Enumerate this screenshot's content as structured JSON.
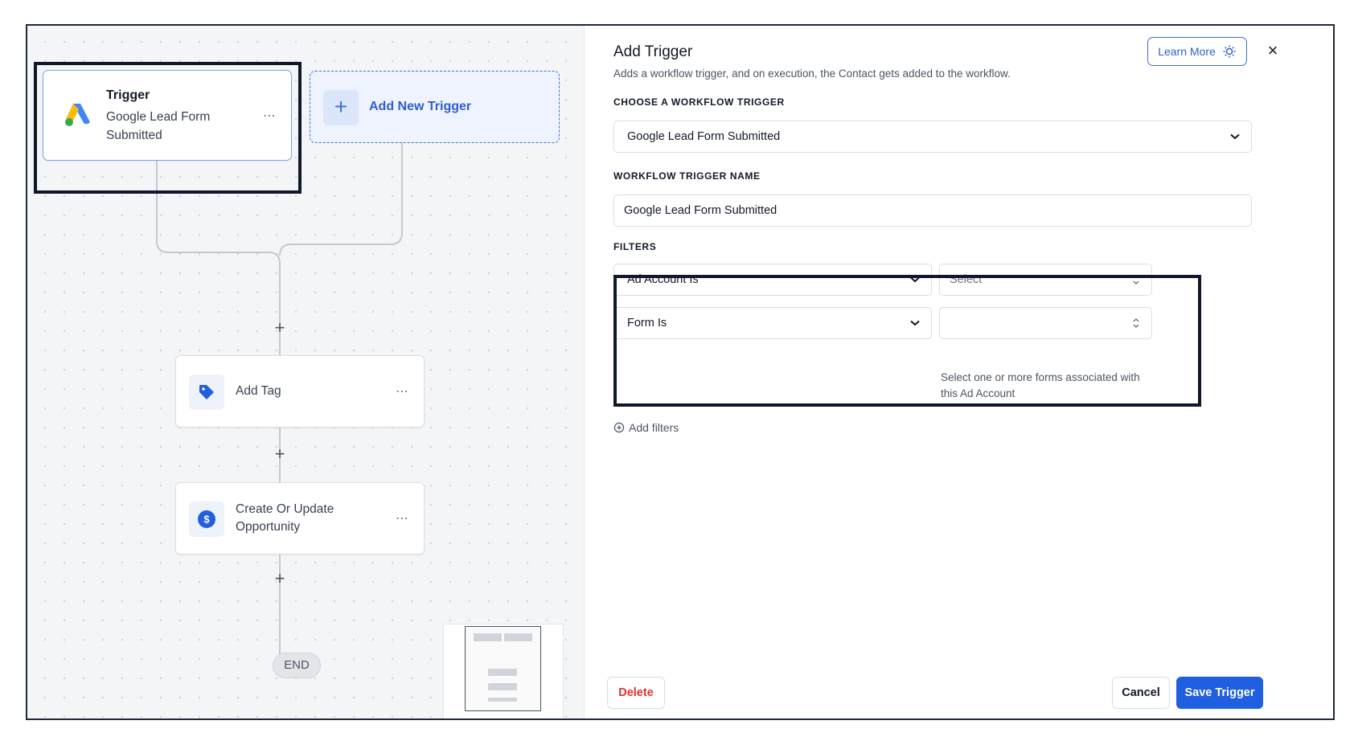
{
  "canvas": {
    "trigger_node": {
      "title": "Trigger",
      "subtitle": "Google Lead Form Submitted",
      "menu": "⋯"
    },
    "add_trigger": {
      "label": "Add New Trigger",
      "plus": "+"
    },
    "connector_plus": "+",
    "actions": [
      {
        "label": "Add Tag",
        "icon": "tag-icon",
        "menu": "⋯"
      },
      {
        "label": "Create Or Update Opportunity",
        "icon": "dollar-icon",
        "menu": "⋯"
      }
    ],
    "end_label": "END"
  },
  "panel": {
    "title": "Add Trigger",
    "description": "Adds a workflow trigger, and on execution, the Contact gets added to the workflow.",
    "learn_more": "Learn More",
    "close": "×",
    "choose_trigger_label": "CHOOSE A WORKFLOW TRIGGER",
    "choose_trigger_value": "Google Lead Form Submitted",
    "trigger_name_label": "WORKFLOW TRIGGER NAME",
    "trigger_name_value": "Google Lead Form Submitted",
    "filters_label": "FILTERS",
    "filters": [
      {
        "field": "Ad Account Is",
        "value": "Select"
      },
      {
        "field": "Form Is",
        "value": ""
      }
    ],
    "form_hint": "Select one or more forms associated with this Ad Account",
    "add_filters": "Add filters",
    "delete": "Delete",
    "cancel": "Cancel",
    "save": "Save Trigger"
  },
  "colors": {
    "accent": "#1f5fe0",
    "accent_text": "#2f5fcf",
    "danger": "#e03131",
    "highlight_border": "#0f172a"
  }
}
